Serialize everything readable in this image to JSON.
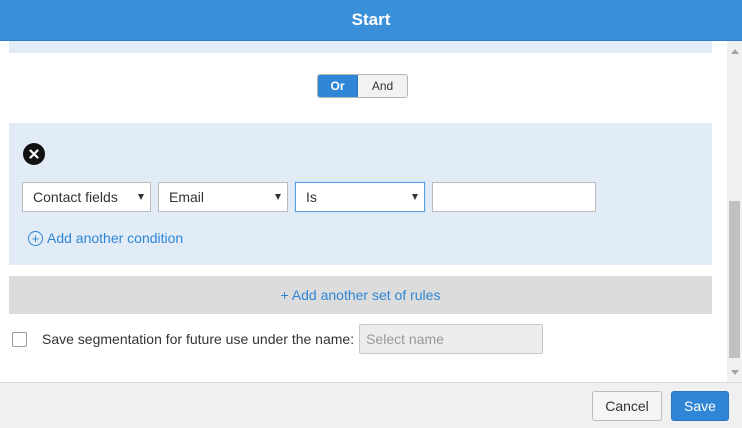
{
  "dialog": {
    "title": "Start"
  },
  "logic_toggle": {
    "or_label": "Or",
    "and_label": "And",
    "selected": "Or"
  },
  "condition": {
    "field_category": "Contact fields",
    "field": "Email",
    "operator": "Is",
    "value": ""
  },
  "add_condition_label": "Add another condition",
  "add_ruleset_label": "+ Add another set of rules",
  "save_segmentation": {
    "checked": false,
    "label": "Save segmentation for future use under the name:",
    "name_placeholder": "Select name"
  },
  "footer": {
    "cancel_label": "Cancel",
    "save_label": "Save"
  },
  "icons": {
    "remove": "close-icon",
    "add_condition": "plus-circle-icon",
    "dropdown": "caret-down-icon"
  },
  "colors": {
    "accent": "#2f86d6",
    "header": "#3a8fd9",
    "ruleset_bg": "#e1ecf7"
  }
}
